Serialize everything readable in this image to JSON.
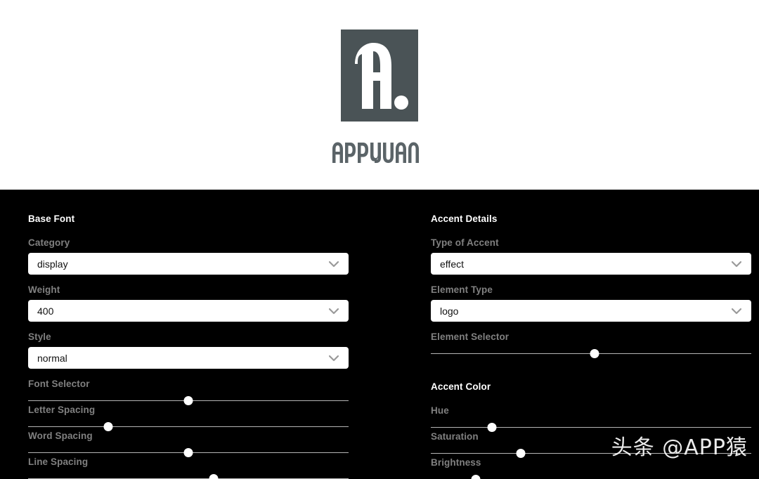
{
  "preview": {
    "logo_mark_color": "#4a5356",
    "logo_glyph": "A.",
    "wordmark": "APPYUAN",
    "background": "#ffffff"
  },
  "controls": {
    "background": "#000000",
    "left_panel": {
      "section_title": "Base Font",
      "selects": [
        {
          "label": "Category",
          "value": "display",
          "icon": "chevron-down-icon"
        },
        {
          "label": "Weight",
          "value": "400",
          "icon": "chevron-down-icon"
        },
        {
          "label": "Style",
          "value": "normal",
          "icon": "chevron-down-icon"
        }
      ],
      "sliders": [
        {
          "label": "Font Selector",
          "percent": 50
        },
        {
          "label": "Letter Spacing",
          "percent": 25
        },
        {
          "label": "Word Spacing",
          "percent": 50
        },
        {
          "label": "Line Spacing",
          "percent": 58
        }
      ]
    },
    "right_panel": {
      "section_title": "Accent Details",
      "selects": [
        {
          "label": "Type of Accent",
          "value": "effect",
          "icon": "chevron-down-icon"
        },
        {
          "label": "Element Type",
          "value": "logo",
          "icon": "chevron-down-icon"
        }
      ],
      "sliders": [
        {
          "label": "Element Selector",
          "percent": 51
        }
      ],
      "color_section_title": "Accent Color",
      "color_sliders": [
        {
          "label": "Hue",
          "percent": 19
        },
        {
          "label": "Saturation",
          "percent": 28
        },
        {
          "label": "Brightness",
          "percent": 14
        }
      ]
    }
  },
  "watermark": {
    "text": "头条 @APP猿"
  }
}
